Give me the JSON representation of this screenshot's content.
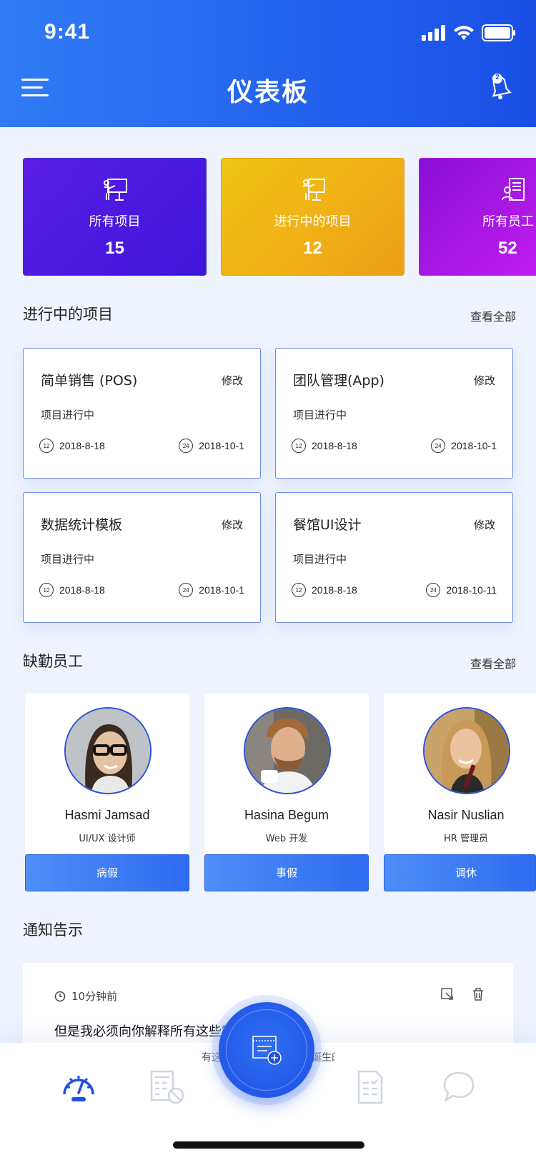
{
  "status_bar": {
    "time": "9:41"
  },
  "header": {
    "title": "仪表板",
    "bell_badge": "2"
  },
  "summary": [
    {
      "label": "所有项目",
      "value": "15",
      "icon": "presentation-board-icon"
    },
    {
      "label": "进行中的项目",
      "value": "12",
      "icon": "presenter-icon"
    },
    {
      "label": "所有员工",
      "value": "52",
      "icon": "employee-directory-icon"
    }
  ],
  "projects_section": {
    "title": "进行中的项目",
    "see_all": "查看全部"
  },
  "projects": [
    {
      "name": "简单销售 (POS)",
      "edit": "修改",
      "status": "项目进行中",
      "start_badge": "12",
      "start": "2018-8-18",
      "end_badge": "24",
      "end": "2018-10-1"
    },
    {
      "name": "团队管理(App)",
      "edit": "修改",
      "status": "项目进行中",
      "start_badge": "12",
      "start": "2018-8-18",
      "end_badge": "24",
      "end": "2018-10-1"
    },
    {
      "name": "数据统计模板",
      "edit": "修改",
      "status": "项目进行中",
      "start_badge": "12",
      "start": "2018-8-18",
      "end_badge": "24",
      "end": "2018-10-1"
    },
    {
      "name": "餐馆UI设计",
      "edit": "修改",
      "status": "项目进行中",
      "start_badge": "12",
      "start": "2018-8-18",
      "end_badge": "24",
      "end": "2018-10-11"
    }
  ],
  "absent_section": {
    "title": "缺勤员工",
    "see_all": "查看全部"
  },
  "employees": [
    {
      "name": "Hasmi Jamsad",
      "role": "UI/UX 设计师",
      "leave": "病假"
    },
    {
      "name": "Hasina Begum",
      "role": "Web 开发",
      "leave": "事假"
    },
    {
      "name": "Nasir Nuslian",
      "role": "HR 管理员",
      "leave": "调休"
    }
  ],
  "notice_section": {
    "title": "通知告示"
  },
  "notice": {
    "time": "10分钟前",
    "text": "但是我必须向你解释所有这些错误的想法。",
    "text2": "有这些错误的想法是如何诞生的谴责快乐和赞美"
  },
  "colors": {
    "brand": "#1d4fe3",
    "card_purple": "#4a1ae0",
    "card_yellow": "#efb016",
    "card_magenta": "#b41ee8"
  }
}
